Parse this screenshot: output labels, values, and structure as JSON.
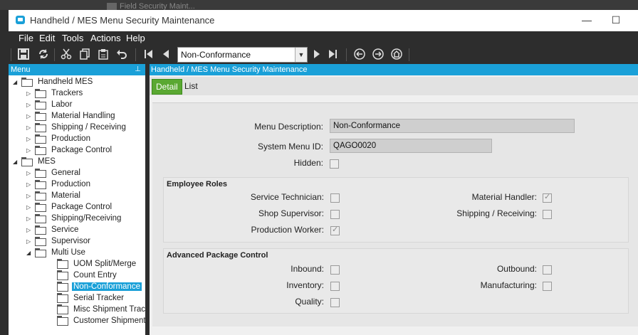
{
  "background_window": {
    "title_fragment": "Field Security Maint..."
  },
  "window": {
    "title": "Handheld / MES Menu Security Maintenance",
    "minimize": "—",
    "maximize": "☐"
  },
  "menubar": {
    "items": [
      "File",
      "Edit",
      "Tools",
      "Actions",
      "Help"
    ]
  },
  "toolbar": {
    "icons": [
      "save-icon",
      "refresh-icon",
      "cut-icon",
      "copy-icon",
      "paste-icon",
      "undo-icon",
      "first-record-icon",
      "previous-record-icon",
      "next-record-icon",
      "last-record-icon",
      "back-icon",
      "forward-icon",
      "home-icon"
    ],
    "record_combo_value": "Non-Conformance"
  },
  "sidebar": {
    "title": "Menu",
    "pin": "⊥",
    "tree": [
      {
        "label": "Handheld MES",
        "level": 0,
        "expanded": true,
        "type": "folder"
      },
      {
        "label": "Trackers",
        "level": 1,
        "expanded": false,
        "type": "folder"
      },
      {
        "label": "Labor",
        "level": 1,
        "expanded": false,
        "type": "folder"
      },
      {
        "label": "Material Handling",
        "level": 1,
        "expanded": false,
        "type": "folder"
      },
      {
        "label": "Shipping / Receiving",
        "level": 1,
        "expanded": false,
        "type": "folder"
      },
      {
        "label": "Production",
        "level": 1,
        "expanded": false,
        "type": "folder"
      },
      {
        "label": "Package Control",
        "level": 1,
        "expanded": false,
        "type": "folder"
      },
      {
        "label": "MES",
        "level": 0,
        "expanded": true,
        "type": "folder"
      },
      {
        "label": "General",
        "level": 1,
        "expanded": false,
        "type": "folder"
      },
      {
        "label": "Production",
        "level": 1,
        "expanded": false,
        "type": "folder"
      },
      {
        "label": "Material",
        "level": 1,
        "expanded": false,
        "type": "folder"
      },
      {
        "label": "Package Control",
        "level": 1,
        "expanded": false,
        "type": "folder"
      },
      {
        "label": "Shipping/Receiving",
        "level": 1,
        "expanded": false,
        "type": "folder"
      },
      {
        "label": "Service",
        "level": 1,
        "expanded": false,
        "type": "folder"
      },
      {
        "label": "Supervisor",
        "level": 1,
        "expanded": false,
        "type": "folder"
      },
      {
        "label": "Multi Use",
        "level": 1,
        "expanded": true,
        "type": "folder"
      },
      {
        "label": "UOM Split/Merge",
        "level": 2,
        "type": "doc"
      },
      {
        "label": "Count Entry",
        "level": 2,
        "type": "doc"
      },
      {
        "label": "Non-Conformance",
        "level": 2,
        "type": "doc",
        "selected": true
      },
      {
        "label": "Serial Tracker",
        "level": 2,
        "type": "doc"
      },
      {
        "label": "Misc Shipment Track",
        "level": 2,
        "type": "doc"
      },
      {
        "label": "Customer Shipment T",
        "level": 2,
        "type": "doc"
      }
    ]
  },
  "main": {
    "header": "Handheld / MES Menu Security Maintenance",
    "tabs": [
      "Detail",
      "List"
    ],
    "form": {
      "menu_description_label": "Menu Description:",
      "menu_description_value": "Non-Conformance",
      "system_menu_id_label": "System Menu ID:",
      "system_menu_id_value": "QAGO0020",
      "hidden_label": "Hidden:",
      "hidden_checked": false
    },
    "employee_roles": {
      "title": "Employee Roles",
      "service_technician": {
        "label": "Service Technician:",
        "checked": false
      },
      "shop_supervisor": {
        "label": "Shop Supervisor:",
        "checked": false
      },
      "production_worker": {
        "label": "Production Worker:",
        "checked": true
      },
      "material_handler": {
        "label": "Material Handler:",
        "checked": true
      },
      "shipping_receiving": {
        "label": "Shipping / Receiving:",
        "checked": false
      }
    },
    "advanced_package_control": {
      "title": "Advanced Package Control",
      "inbound": {
        "label": "Inbound:",
        "checked": false
      },
      "inventory": {
        "label": "Inventory:",
        "checked": false
      },
      "quality": {
        "label": "Quality:",
        "checked": false
      },
      "outbound": {
        "label": "Outbound:",
        "checked": false
      },
      "manufacturing": {
        "label": "Manufacturing:",
        "checked": false
      }
    }
  },
  "colors": {
    "accent": "#1aa0d8",
    "active_tab": "#5aa832",
    "chrome": "#2d2d2d"
  }
}
